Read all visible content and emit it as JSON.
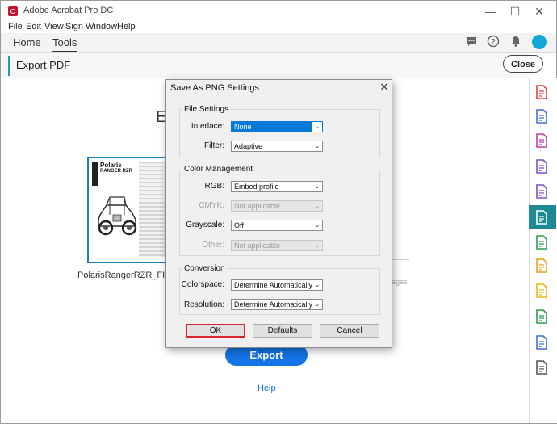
{
  "app": {
    "title": "Adobe Acrobat Pro DC",
    "window_controls": [
      "—",
      "☐",
      "✕"
    ]
  },
  "menu": [
    "File",
    "Edit",
    "View",
    "Sign",
    "Window",
    "Help"
  ],
  "nav": {
    "tabs": [
      "Home",
      "Tools"
    ],
    "active_tab": "Tools",
    "icons": [
      "chat-icon",
      "help-icon",
      "bell-icon",
      "avatar"
    ]
  },
  "export_panel": {
    "title": "Export PDF",
    "close_label": "Close",
    "heading_partial": "E",
    "file_thumbnail": {
      "title_line1": "Polaris",
      "title_line2": "RANGER RZR"
    },
    "file_name": "PolarisRangerRZR_FI00...",
    "faded_text": "ages",
    "export_label": "Export",
    "help_label": "Help"
  },
  "dialog": {
    "title": "Save As PNG Settings",
    "close_glyph": "✕",
    "file_settings": {
      "label": "File Settings",
      "interlace": {
        "label": "Interlace:",
        "value": "None"
      },
      "filter": {
        "label": "Filter:",
        "value": "Adaptive"
      }
    },
    "color_management": {
      "label": "Color Management",
      "rgb": {
        "label": "RGB:",
        "value": "Embed profile"
      },
      "cmyk": {
        "label": "CMYK:",
        "value": "Not applicable"
      },
      "grayscale": {
        "label": "Grayscale:",
        "value": "Off"
      },
      "other": {
        "label": "Other:",
        "value": "Not applicable"
      }
    },
    "conversion": {
      "label": "Conversion",
      "colorspace": {
        "label": "Colorspace:",
        "value": "Determine Automatically"
      },
      "resolution": {
        "label": "Resolution:",
        "value": "Determine Automatically"
      }
    },
    "buttons": {
      "ok": "OK",
      "defaults": "Defaults",
      "cancel": "Cancel"
    }
  },
  "right_rail": [
    {
      "icon": "create-pdf-icon",
      "color": "#e0413a"
    },
    {
      "icon": "export-pdf-icon",
      "color": "#3b6fd8"
    },
    {
      "icon": "organize-pages-icon",
      "color": "#c33aa8"
    },
    {
      "icon": "compare-icon",
      "color": "#7a4fcf"
    },
    {
      "icon": "fill-sign-icon",
      "color": "#7a4fcf"
    },
    {
      "icon": "export-pdf-active-icon",
      "color": "#ffffff"
    },
    {
      "icon": "edit-pdf-icon",
      "color": "#2f9b52"
    },
    {
      "icon": "combine-icon",
      "color": "#e8a317"
    },
    {
      "icon": "comment-icon",
      "color": "#e8b80e"
    },
    {
      "icon": "print-icon",
      "color": "#2f9b52"
    },
    {
      "icon": "protect-icon",
      "color": "#3b6fd8"
    },
    {
      "icon": "more-tools-icon",
      "color": "#555555"
    }
  ],
  "colors": {
    "accent_blue": "#1473e6",
    "teal": "#1e8a96",
    "highlight_red": "#d9232e",
    "focus_blue": "#0078d7"
  }
}
